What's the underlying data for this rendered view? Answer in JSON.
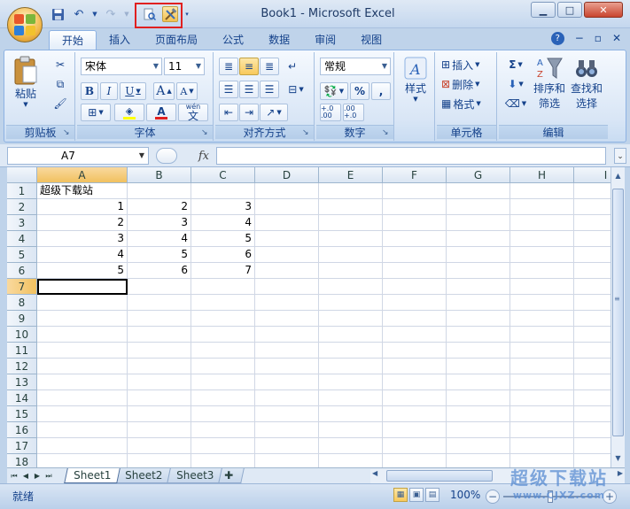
{
  "window": {
    "title": "Book1 - Microsoft Excel",
    "minimize_icon": "minimize-icon",
    "maximize_icon": "maximize-icon",
    "close_icon": "close-icon"
  },
  "quick_access": {
    "save_icon": "save-icon",
    "undo_icon": "undo-icon",
    "redo_icon": "redo-icon",
    "print_preview_icon": "print-preview-icon",
    "tools_icon": "tools-icon"
  },
  "ribbon": {
    "tabs": [
      "开始",
      "插入",
      "页面布局",
      "公式",
      "数据",
      "审阅",
      "视图"
    ],
    "active_tab": "开始",
    "clipboard": {
      "paste_label": "粘贴",
      "group_label": "剪贴板"
    },
    "font": {
      "name": "宋体",
      "size": "11",
      "bold": "B",
      "italic": "I",
      "underline": "U",
      "grow": "A",
      "shrink": "A",
      "group_label": "字体",
      "font_color": "#e02020",
      "fill_color": "#ffff00",
      "phonetic_label": "wén"
    },
    "alignment": {
      "group_label": "对齐方式"
    },
    "number": {
      "format": "常规",
      "percent": "%",
      "comma": ",",
      "inc_decimal": "+.0 .00",
      "dec_decimal": ".00 +.0",
      "group_label": "数字"
    },
    "styles": {
      "label": "样式"
    },
    "cells": {
      "insert": "插入",
      "delete": "删除",
      "format": "格式",
      "group_label": "单元格"
    },
    "editing": {
      "sum": "Σ",
      "sort_filter_line1": "排序和",
      "sort_filter_line2": "筛选",
      "find_select_line1": "查找和",
      "find_select_line2": "选择",
      "group_label": "编辑"
    }
  },
  "formula_bar": {
    "name_box": "A7",
    "fx_label": "fx",
    "formula": ""
  },
  "sheet": {
    "columns": [
      "A",
      "B",
      "C",
      "D",
      "E",
      "F",
      "G",
      "H",
      "I"
    ],
    "rows": [
      "1",
      "2",
      "3",
      "4",
      "5",
      "6",
      "7",
      "8",
      "9",
      "10",
      "11",
      "12",
      "13",
      "14",
      "15",
      "16",
      "17",
      "18"
    ],
    "selected_col": "A",
    "selected_row": "7",
    "cells": {
      "A1": "超级下载站",
      "A2": "1",
      "B2": "2",
      "C2": "3",
      "A3": "2",
      "B3": "3",
      "C3": "4",
      "A4": "3",
      "B4": "4",
      "C4": "5",
      "A5": "4",
      "B5": "5",
      "C5": "6",
      "A6": "5",
      "B6": "6",
      "C6": "7"
    }
  },
  "sheet_tabs": [
    "Sheet1",
    "Sheet2",
    "Sheet3"
  ],
  "active_sheet": "Sheet1",
  "status": {
    "ready": "就绪",
    "zoom": "100%",
    "zoom_out": "−",
    "zoom_in": "+"
  },
  "watermark": {
    "title": "超级下载站",
    "url": "www.CJXZ.com"
  }
}
